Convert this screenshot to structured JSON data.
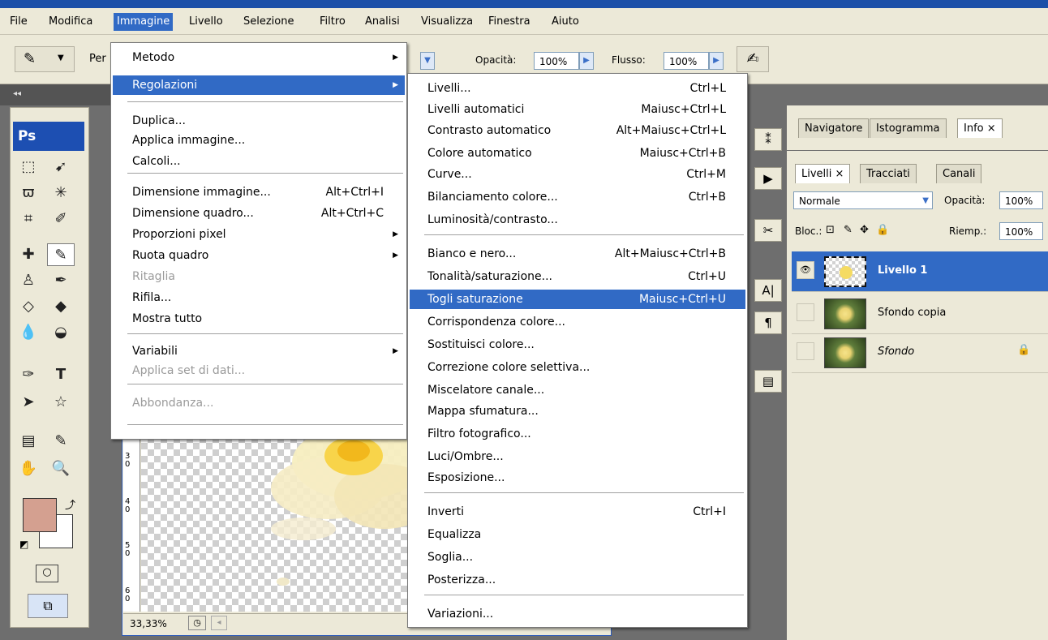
{
  "menubar": {
    "items": [
      "File",
      "Modifica",
      "Immagine",
      "Livello",
      "Selezione",
      "Filtro",
      "Analisi",
      "Visualizza",
      "Finestra",
      "Aiuto"
    ]
  },
  "options_bar": {
    "truncated_label": "Per",
    "opacity_label": "Opacità:",
    "opacity_value": "100%",
    "flow_label": "Flusso:",
    "flow_value": "100%"
  },
  "toolbox": {
    "logo": "Ps",
    "foreground_color": "#d4a090",
    "background_color": "#ffffff"
  },
  "document": {
    "zoom": "33,33%",
    "ruler_marks": [
      "3\n0",
      "4\n0",
      "5\n0",
      "6\n0"
    ]
  },
  "immagine_menu": {
    "items": [
      {
        "label": "Metodo",
        "shortcut": "",
        "submenu": true,
        "disabled": false
      },
      {
        "label": "Regolazioni",
        "shortcut": "",
        "submenu": true,
        "disabled": false,
        "highlighted": true
      },
      {
        "label": "Duplica...",
        "shortcut": "",
        "submenu": false,
        "disabled": false
      },
      {
        "label": "Applica immagine...",
        "shortcut": "",
        "submenu": false,
        "disabled": false
      },
      {
        "label": "Calcoli...",
        "shortcut": "",
        "submenu": false,
        "disabled": false
      },
      {
        "label": "Dimensione immagine...",
        "shortcut": "Alt+Ctrl+I",
        "submenu": false,
        "disabled": false
      },
      {
        "label": "Dimensione quadro...",
        "shortcut": "Alt+Ctrl+C",
        "submenu": false,
        "disabled": false
      },
      {
        "label": "Proporzioni pixel",
        "shortcut": "",
        "submenu": true,
        "disabled": false
      },
      {
        "label": "Ruota quadro",
        "shortcut": "",
        "submenu": true,
        "disabled": false
      },
      {
        "label": "Ritaglia",
        "shortcut": "",
        "submenu": false,
        "disabled": true
      },
      {
        "label": "Rifila...",
        "shortcut": "",
        "submenu": false,
        "disabled": false
      },
      {
        "label": "Mostra tutto",
        "shortcut": "",
        "submenu": false,
        "disabled": false
      },
      {
        "label": "Variabili",
        "shortcut": "",
        "submenu": true,
        "disabled": false
      },
      {
        "label": "Applica set di dati...",
        "shortcut": "",
        "submenu": false,
        "disabled": true
      },
      {
        "label": "Abbondanza...",
        "shortcut": "",
        "submenu": false,
        "disabled": true
      }
    ]
  },
  "regolazioni_menu": {
    "items": [
      {
        "label": "Livelli...",
        "shortcut": "Ctrl+L"
      },
      {
        "label": "Livelli automatici",
        "shortcut": "Maiusc+Ctrl+L"
      },
      {
        "label": "Contrasto automatico",
        "shortcut": "Alt+Maiusc+Ctrl+L"
      },
      {
        "label": "Colore automatico",
        "shortcut": "Maiusc+Ctrl+B"
      },
      {
        "label": "Curve...",
        "shortcut": "Ctrl+M"
      },
      {
        "label": "Bilanciamento colore...",
        "shortcut": "Ctrl+B"
      },
      {
        "label": "Luminosità/contrasto...",
        "shortcut": ""
      },
      {
        "label": "Bianco e nero...",
        "shortcut": "Alt+Maiusc+Ctrl+B"
      },
      {
        "label": "Tonalità/saturazione...",
        "shortcut": "Ctrl+U"
      },
      {
        "label": "Togli saturazione",
        "shortcut": "Maiusc+Ctrl+U",
        "highlighted": true
      },
      {
        "label": "Corrispondenza colore...",
        "shortcut": ""
      },
      {
        "label": "Sostituisci colore...",
        "shortcut": ""
      },
      {
        "label": "Correzione colore selettiva...",
        "shortcut": ""
      },
      {
        "label": "Miscelatore canale...",
        "shortcut": ""
      },
      {
        "label": "Mappa sfumatura...",
        "shortcut": ""
      },
      {
        "label": "Filtro fotografico...",
        "shortcut": ""
      },
      {
        "label": "Luci/Ombre...",
        "shortcut": ""
      },
      {
        "label": "Esposizione...",
        "shortcut": ""
      },
      {
        "label": "Inverti",
        "shortcut": "Ctrl+I"
      },
      {
        "label": "Equalizza",
        "shortcut": ""
      },
      {
        "label": "Soglia...",
        "shortcut": ""
      },
      {
        "label": "Posterizza...",
        "shortcut": ""
      },
      {
        "label": "Variazioni...",
        "shortcut": ""
      }
    ]
  },
  "nav_panel": {
    "tabs": [
      "Navigatore",
      "Istogramma",
      "Info"
    ]
  },
  "layers_panel": {
    "tabs": [
      "Livelli",
      "Tracciati",
      "Canali"
    ],
    "blend_mode": "Normale",
    "opacity_label": "Opacità:",
    "opacity_value": "100%",
    "lock_label": "Bloc.:",
    "fill_label": "Riemp.:",
    "fill_value": "100%",
    "layers": [
      {
        "name": "Livello 1",
        "selected": true,
        "visible": true
      },
      {
        "name": "Sfondo copia",
        "selected": false,
        "visible": false
      },
      {
        "name": "Sfondo",
        "selected": false,
        "visible": false,
        "locked": true
      }
    ]
  },
  "icons": {
    "close_tab": "×",
    "dropdown": "chevron-down-icon",
    "submenu": "triangle-right-icon",
    "eye": "eye-icon",
    "lock": "lock-icon"
  }
}
